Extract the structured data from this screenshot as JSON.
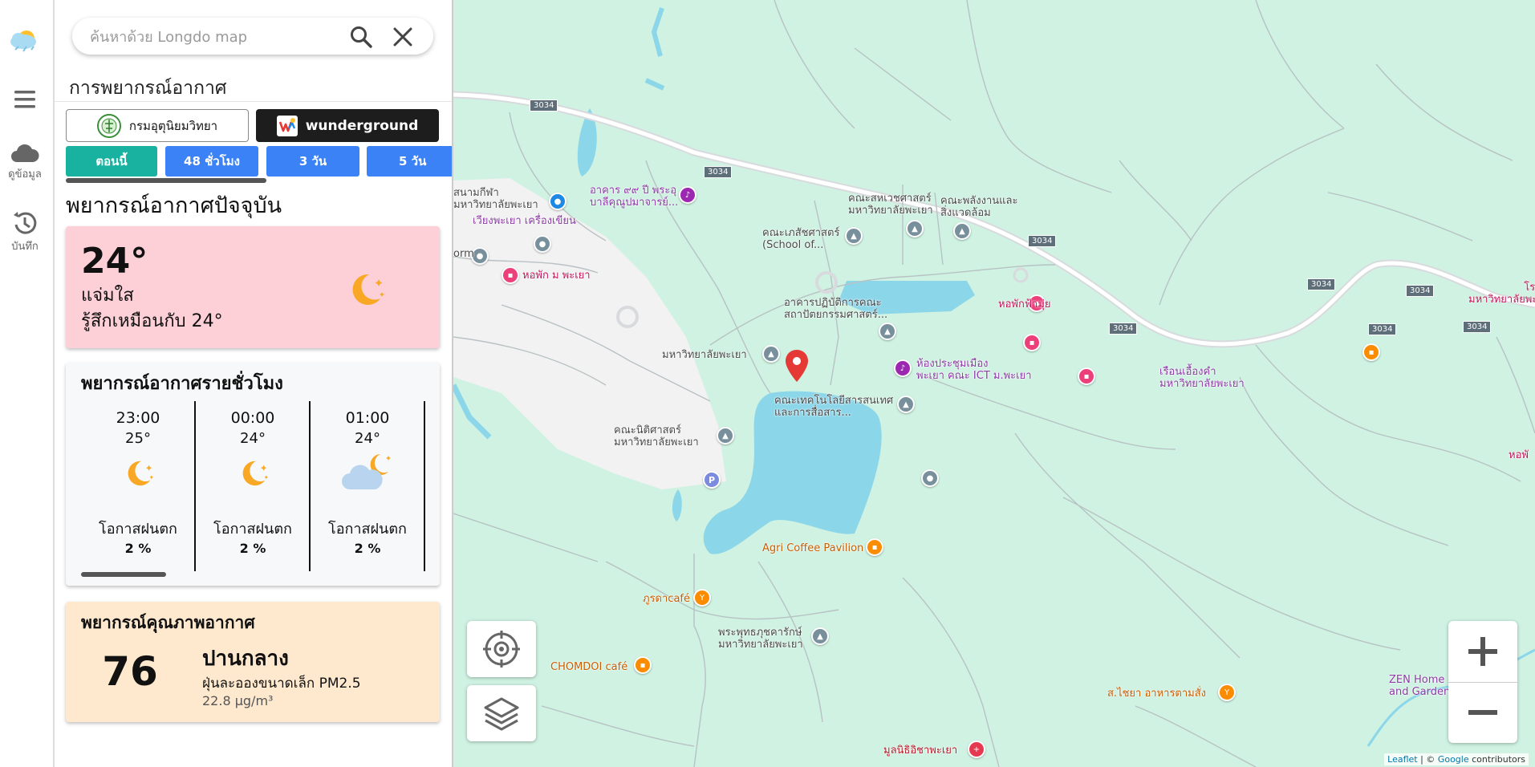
{
  "rail": {
    "items": [
      {
        "label": "ดูข้อมูล",
        "icon": "cloud-icon"
      },
      {
        "label": "บันทึก",
        "icon": "history-icon"
      }
    ]
  },
  "search": {
    "placeholder": "ค้นหาด้วย Longdo map"
  },
  "panel": {
    "title": "การพยากรณ์อากาศ",
    "sources": [
      {
        "label": "กรมอุตุนิยมวิทยา"
      },
      {
        "label": "wunderground"
      }
    ],
    "tabs": [
      {
        "label": "ตอนนี้",
        "color": "#19b2a0"
      },
      {
        "label": "48 ชั่วโมง",
        "color": "#3b82f6"
      },
      {
        "label": "3 วัน",
        "color": "#3b82f6"
      },
      {
        "label": "5 วัน",
        "color": "#3b82f6"
      }
    ]
  },
  "current": {
    "heading": "พยากรณ์อากาศปัจจุบัน",
    "temp": "24°",
    "condition": "แจ่มใส",
    "feels_like": "รู้สึกเหมือนกับ 24°",
    "icon": "moon-icon"
  },
  "hourly": {
    "heading": "พยากรณ์อากาศรายชั่วโมง",
    "items": [
      {
        "time": "23:00",
        "temp": "25°",
        "icon": "moon-icon",
        "rain_label": "โอกาสฝนตก",
        "rain": "2 %"
      },
      {
        "time": "00:00",
        "temp": "24°",
        "icon": "moon-icon",
        "rain_label": "โอกาสฝนตก",
        "rain": "2 %"
      },
      {
        "time": "01:00",
        "temp": "24°",
        "icon": "cloud-moon-icon",
        "rain_label": "โอกาสฝนตก",
        "rain": "2 %"
      }
    ]
  },
  "air": {
    "heading": "พยากรณ์คุณภาพอากาศ",
    "value": "76",
    "level": "ปานกลาง",
    "pollutant": "ฝุ่นละอองขนาดเล็ก PM2.5",
    "concentration": "22.8 µg/m³"
  },
  "map": {
    "shield": "3034",
    "labels": {
      "stadium": "สนามกีฬา\nมหาวิทยาลัยพะเยา",
      "building99": "อาคาร ๙๙ ปี พระอุ\nบาลีคุณูปมาจารย์...",
      "wiangphayao": "เวียงพะเยา เครื่องเขียน",
      "pharm": "คณะเภสัชศาสตร์\n(School of...",
      "alliedhealth": "คณะสหเวชศาสตร์\nมหาวิทยาลัยพะเยา",
      "energy": "คณะพลังงานและ\nสิ่งแวดล้อม",
      "dorm": "orm",
      "hopak": "หอพัก ม พะเยา",
      "agrilab": "อาคารปฏิบัติการคณะ\nสถาปัตยกรรมศาสตร์...",
      "hophamui": "หอพักฟ้ามุ่ย",
      "univ": "มหาวิทยาลัยพะเยา",
      "ict": "ห้องประชุมเมือง\nพะเยา คณะ ICT ม.พะเยา",
      "ruean": "เรือนเอื้องคำ\nมหาวิทยาลัยพะเยา",
      "infotech": "คณะเทคโนโลยีสารสนเทศ\nและการสื่อสาร...",
      "law": "คณะนิติศาสตร์\nมหาวิทยาลัยพะเยา",
      "agri_coffee": "Agri Coffee Pavilion",
      "phuda": "ภูรดาcafé",
      "buddha": "พระพุทธภุชคารักษ์\nมหาวิทยาลัยพะเยา",
      "chomdoi": "CHOMDOI café",
      "sachaiya": "ส.ไชยา อาหารตามสั่ง",
      "mulnithi": "มูลนิธิอิชาพะเยา",
      "zen": "ZEN Home\nand Garden",
      "rongphu": "โรงพย\nมหาวิทยาลัยพะเยา",
      "hopak_edge": "หอพั"
    },
    "attribution": {
      "leaflet": "Leaflet",
      "sep": " | © ",
      "google": "Google",
      "rest": " contributors"
    }
  }
}
